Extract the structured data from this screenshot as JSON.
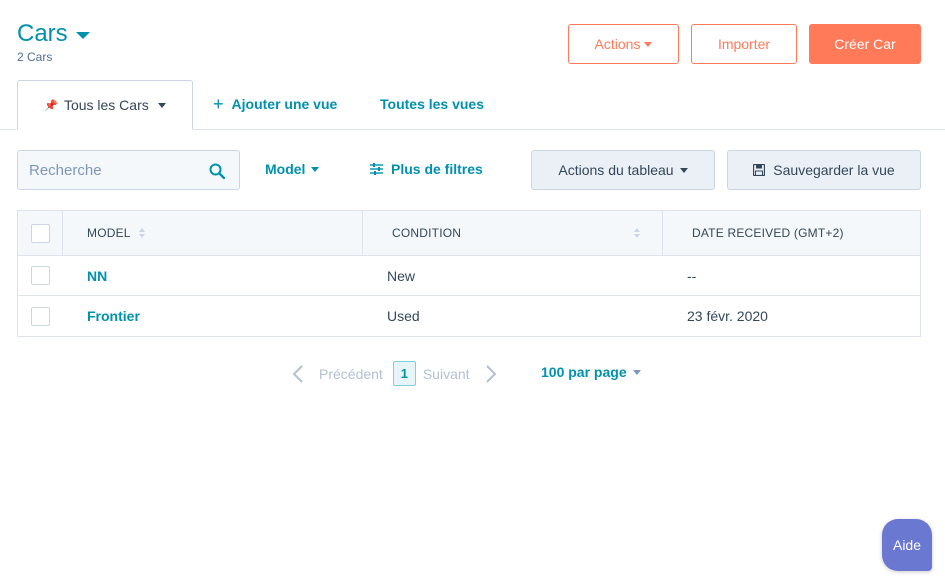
{
  "header": {
    "title": "Cars",
    "subtitle": "2 Cars",
    "actions_label": "Actions",
    "import_label": "Importer",
    "create_label": "Créer Car"
  },
  "tabs": {
    "active_label": "Tous les Cars",
    "add_view_label": "Ajouter une vue",
    "all_views_label": "Toutes les vues"
  },
  "toolbar": {
    "search_placeholder": "Recherche",
    "model_filter_label": "Model",
    "more_filters_label": "Plus de filtres",
    "table_actions_label": "Actions du tableau",
    "save_view_label": "Sauvegarder la vue"
  },
  "table": {
    "columns": [
      "MODEL",
      "CONDITION",
      "DATE RECEIVED (GMT+2)"
    ],
    "rows": [
      {
        "model": "NN",
        "condition": "New",
        "date": "--"
      },
      {
        "model": "Frontier",
        "condition": "Used",
        "date": "23 févr. 2020"
      }
    ]
  },
  "pagination": {
    "prev_label": "Précédent",
    "current_page": "1",
    "next_label": "Suivant",
    "per_page_label": "100 par page"
  },
  "help": {
    "label": "Aide"
  },
  "colors": {
    "accent": "#0091ae",
    "primary": "#ff7a59",
    "help": "#6a78d1"
  }
}
